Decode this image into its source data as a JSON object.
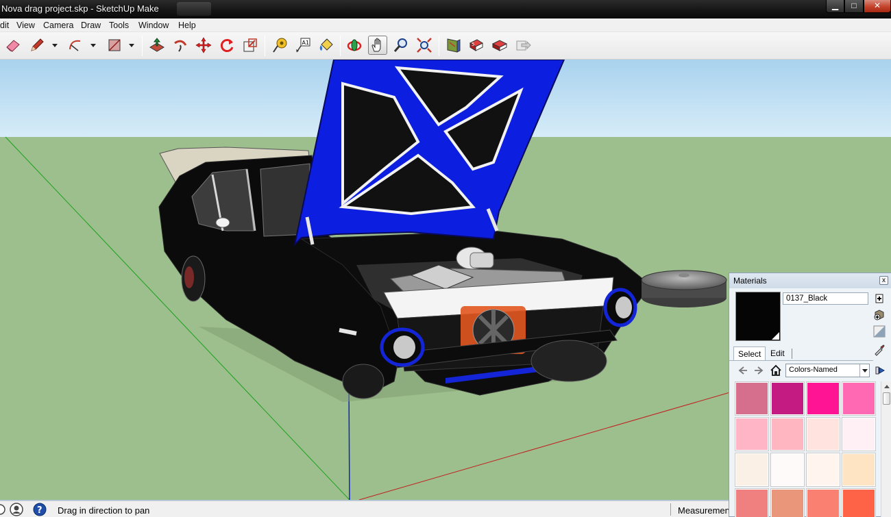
{
  "window": {
    "title": "Nova drag project.skp - SketchUp Make",
    "minimize": "▁",
    "maximize": "□",
    "close": "✕"
  },
  "menu": {
    "items": [
      "dit",
      "View",
      "Camera",
      "Draw",
      "Tools",
      "Window",
      "Help"
    ]
  },
  "toolbar": {
    "tools": [
      "eraser-tool",
      "pencil-tool",
      "arc-tool",
      "rectangle-tool",
      "push-pull-tool",
      "follow-me-tool",
      "move-tool",
      "rotate-tool",
      "scale-tool",
      "tape-measure-tool",
      "text-tool",
      "paint-bucket-tool",
      "orbit-tool",
      "pan-tool",
      "zoom-tool",
      "zoom-extents-tool",
      "warehouse-tool",
      "share-model-tool",
      "extension-warehouse-tool",
      "send-to-layout-tool"
    ],
    "active_tool": "pan-tool",
    "text_tool_glyph": "A1"
  },
  "status": {
    "message": "Drag in direction to pan",
    "measurements_label": "Measurements"
  },
  "materials": {
    "title": "Materials",
    "close": "x",
    "current_name": "0137_Black",
    "current_color": "#050505",
    "tabs": [
      "Select",
      "Edit"
    ],
    "selected_tab": "Select",
    "library": "Colors-Named",
    "swatches": [
      [
        "#d66f8e",
        "#c41b82",
        "#ff1493",
        "#ff69b4"
      ],
      [
        "#ffb5c5",
        "#ffb6c1",
        "#fee3df",
        "#fff0f5"
      ],
      [
        "#fbf0e6",
        "#fffafa",
        "#fff5ee",
        "#ffe4c4"
      ],
      [
        "#f08080",
        "#e9967a",
        "#fa8072",
        "#ff6347"
      ]
    ]
  },
  "scene": {
    "sky": "#b6d8ee",
    "ground": "#9dbe8d",
    "hood": "#0c1ee0",
    "body": "#0a0a0a"
  }
}
